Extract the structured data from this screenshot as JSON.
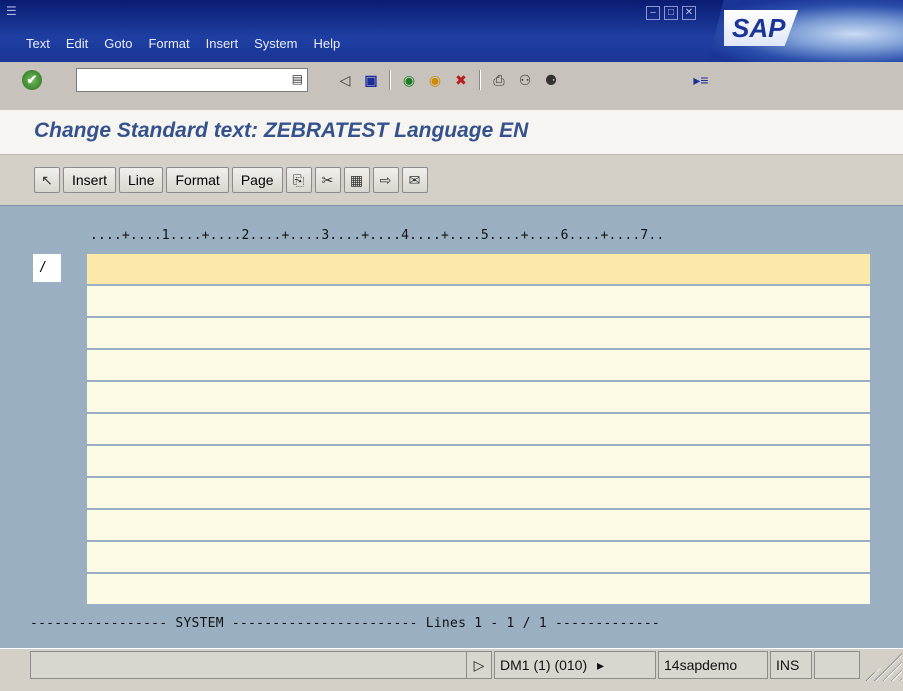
{
  "menu": {
    "items": [
      "Text",
      "Edit",
      "Goto",
      "Format",
      "Insert",
      "System",
      "Help"
    ]
  },
  "logo": "SAP",
  "toolbar": {
    "command_value": "",
    "icons": [
      "enter-icon",
      "back-icon",
      "save-icon",
      "back-green-icon",
      "exit-icon",
      "cancel-icon",
      "print-icon",
      "find-icon",
      "find-next-icon",
      "customize-layout-icon"
    ]
  },
  "title": "Change Standard text: ZEBRATEST Language EN",
  "app_toolbar": {
    "buttons": [
      "Insert",
      "Line",
      "Format",
      "Page"
    ]
  },
  "editor": {
    "ruler": "....+....1....+....2....+....3....+....4....+....5....+....6....+....7..",
    "paragraph_format": "/",
    "footer": "----------------- SYSTEM ----------------------- Lines 1 - 1 / 1 -------------"
  },
  "status": {
    "system": "DM1 (1) (010)",
    "server": "14sapdemo",
    "mode": "INS"
  },
  "colors": {
    "header_blue": "#1a3596",
    "title_text": "#35528c",
    "editor_bg": "#9ab0c2",
    "line_bg": "#fdfbe5",
    "active_line_bg": "#fce8a8"
  }
}
